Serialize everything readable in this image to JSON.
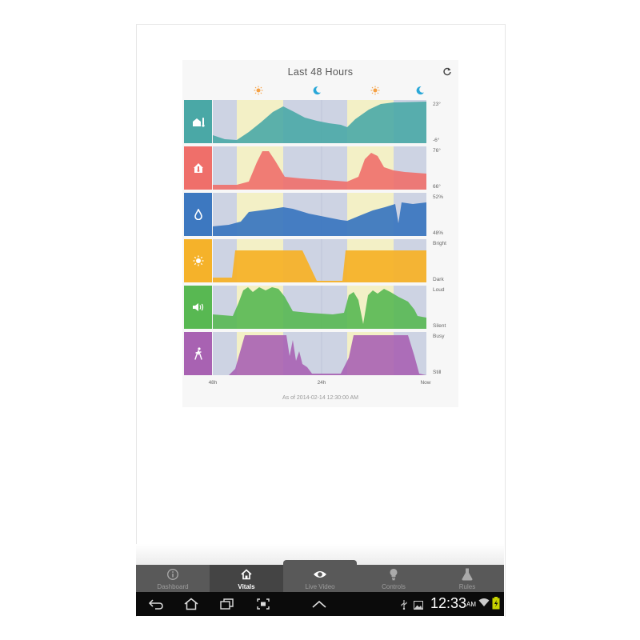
{
  "card": {
    "title": "Last 48 Hours",
    "as_of": "As of 2014-02-14 12:30:00 AM",
    "x_labels": [
      "48h",
      "24h",
      "Now"
    ]
  },
  "day_night_markers": [
    "sun-icon",
    "moon-icon",
    "sun-icon",
    "moon-icon"
  ],
  "chart_data": {
    "type": "area",
    "x_unit": "hours ago",
    "x": [
      48,
      24,
      0
    ],
    "series": [
      {
        "icon": "outside-temperature-icon",
        "color": "#4aa8a6",
        "range_labels": [
          "23°",
          "-6°"
        ]
      },
      {
        "icon": "inside-temperature-icon",
        "color": "#ef6f6a",
        "range_labels": [
          "76°",
          "66°"
        ]
      },
      {
        "icon": "humidity-icon",
        "color": "#3d78c0",
        "range_labels": [
          "52%",
          "48%"
        ]
      },
      {
        "icon": "light-icon",
        "color": "#f5b22a",
        "range_labels": [
          "Bright",
          "Dark"
        ]
      },
      {
        "icon": "sound-icon",
        "color": "#58b852",
        "range_labels": [
          "Loud",
          "Silent"
        ]
      },
      {
        "icon": "motion-icon",
        "color": "#a862b2",
        "range_labels": [
          "Busy",
          "Still"
        ]
      }
    ]
  },
  "tabs": [
    {
      "label": "Dashboard",
      "icon": "info-icon",
      "active": false
    },
    {
      "label": "Vitals",
      "icon": "home-icon",
      "active": true
    },
    {
      "label": "Live Video",
      "icon": "eye-icon",
      "active": false
    },
    {
      "label": "Controls",
      "icon": "bulb-icon",
      "active": false
    },
    {
      "label": "Rules",
      "icon": "flask-icon",
      "active": false
    }
  ],
  "status_bar": {
    "time": "12:33",
    "ampm": "AM"
  },
  "colors": {
    "day_band": "#f3f0c6",
    "night_band": "#cdd3e3",
    "tab_bar": "#595959",
    "nav_bar": "#0b0b0b"
  }
}
